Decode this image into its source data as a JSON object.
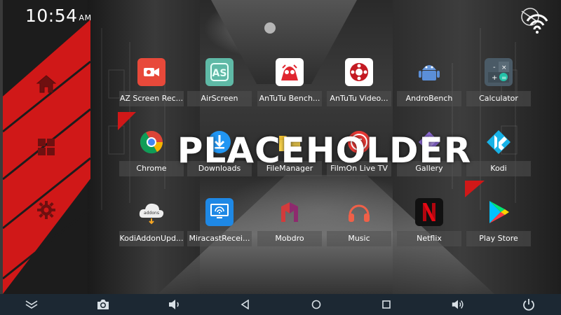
{
  "status": {
    "time": "10:54",
    "ampm": "AM"
  },
  "sidebar": {
    "items": [
      {
        "name": "home-icon"
      },
      {
        "name": "apps-grid-icon"
      },
      {
        "name": "settings-icon"
      }
    ]
  },
  "overlay": {
    "text": "PLACEHOLDER"
  },
  "apps": [
    {
      "label": "AZ Screen Rec...",
      "icon": "az-screen-recorder-icon",
      "color": "#e8493a"
    },
    {
      "label": "AirScreen",
      "icon": "airscreen-icon",
      "color": "#5fb9a6"
    },
    {
      "label": "AnTuTu Bench...",
      "icon": "antutu-benchmark-icon",
      "color": "#ffffff"
    },
    {
      "label": "AnTuTu Video...",
      "icon": "antutu-video-icon",
      "color": "#ffffff"
    },
    {
      "label": "AndroBench",
      "icon": "androbench-icon",
      "color": "#5b8fd8"
    },
    {
      "label": "Calculator",
      "icon": "calculator-icon",
      "color": "#4a5a66"
    },
    {
      "label": "Chrome",
      "icon": "chrome-icon",
      "color": "#ffffff"
    },
    {
      "label": "Downloads",
      "icon": "downloads-icon",
      "color": "#2196f3"
    },
    {
      "label": "FileManager",
      "icon": "file-manager-icon",
      "color": "#f5c430"
    },
    {
      "label": "FilmOn Live TV",
      "icon": "filmon-icon",
      "color": "#e53935"
    },
    {
      "label": "Gallery",
      "icon": "gallery-icon",
      "color": "#8e6bd8"
    },
    {
      "label": "Kodi",
      "icon": "kodi-icon",
      "color": "#17b2e7"
    },
    {
      "label": "KodiAddonUpd...",
      "icon": "kodi-addon-updater-icon",
      "color": "#eeeeee"
    },
    {
      "label": "MiracastRecei...",
      "icon": "miracast-receiver-icon",
      "color": "#1e88e5"
    },
    {
      "label": "Mobdro",
      "icon": "mobdro-icon",
      "color": "#d23b3b"
    },
    {
      "label": "Music",
      "icon": "music-icon",
      "color": "#f06048"
    },
    {
      "label": "Netflix",
      "icon": "netflix-icon",
      "color": "#111111"
    },
    {
      "label": "Play Store",
      "icon": "play-store-icon",
      "color": "#ffffff"
    }
  ],
  "navbar": {
    "items": [
      {
        "name": "expand-icon"
      },
      {
        "name": "screenshot-icon"
      },
      {
        "name": "volume-down-icon"
      },
      {
        "name": "back-icon"
      },
      {
        "name": "home-circle-icon"
      },
      {
        "name": "recents-icon"
      },
      {
        "name": "volume-up-icon"
      },
      {
        "name": "power-icon"
      }
    ]
  },
  "colors": {
    "accent": "#d01818",
    "navbar": "#1c2833"
  }
}
